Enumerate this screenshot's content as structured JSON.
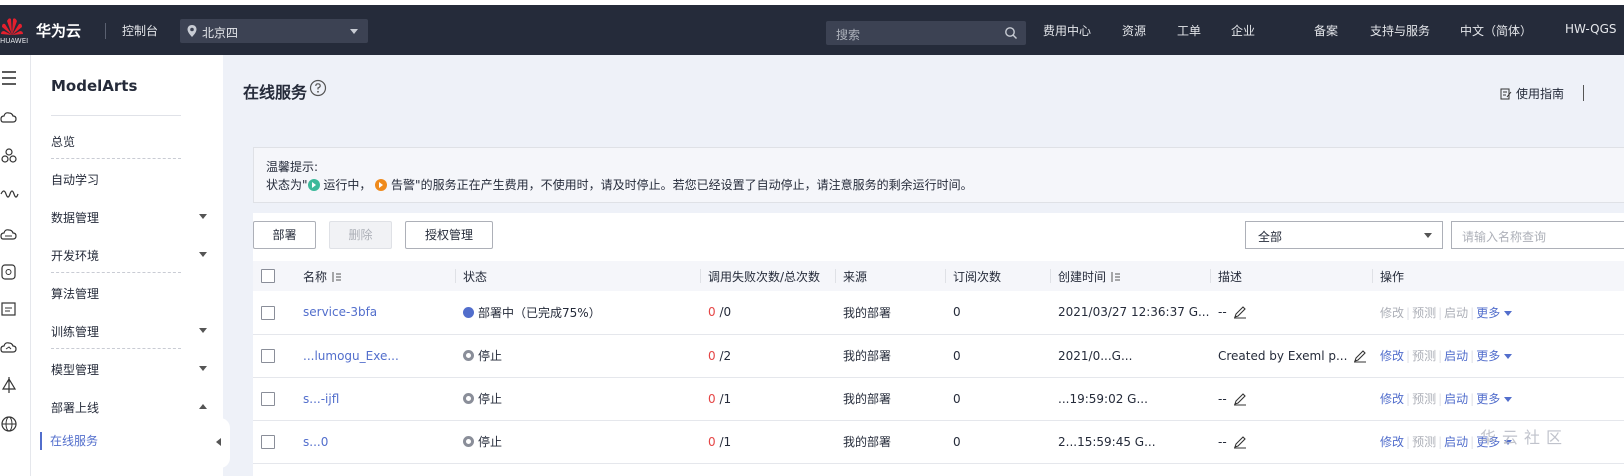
{
  "topbar": {
    "logo_text": "HUAWEI",
    "brand": "华为云",
    "console": "控制台",
    "region": "北京四",
    "search_placeholder": "搜索",
    "nav": [
      "费用中心",
      "资源",
      "工单",
      "企业",
      "备案",
      "支持与服务",
      "中文（简体）",
      "HW-QGS"
    ]
  },
  "sidenav": {
    "title": "ModelArts",
    "items": [
      {
        "label": "总览"
      },
      {
        "label": "自动学习"
      },
      {
        "label": "数据管理"
      },
      {
        "label": "开发环境"
      },
      {
        "label": "算法管理"
      },
      {
        "label": "训练管理"
      },
      {
        "label": "模型管理"
      },
      {
        "label": "部署上线"
      }
    ],
    "subitem": "在线服务"
  },
  "main": {
    "title": "在线服务",
    "guide": "使用指南",
    "tips": {
      "title": "温馨提示:",
      "line_pre": "状态为\"",
      "running": "运行中，",
      "alarm": "告警",
      "line_post": "\"的服务正在产生费用，不使用时，请及时停止。若您已经设置了自动停止，请注意服务的剩余运行时间。"
    },
    "buttons": {
      "deploy": "部署",
      "delete": "删除",
      "auth": "授权管理"
    },
    "filter": {
      "selected": "全部",
      "name_placeholder": "请输入名称查询"
    },
    "columns": [
      "名称",
      "状态",
      "调用失败次数/总次数",
      "来源",
      "订阅次数",
      "创建时间",
      "描述",
      "操作"
    ],
    "rows": [
      {
        "name": "service-3bfa",
        "status": "部署中",
        "status_extra": "（已完成75%）",
        "status_type": "deploying",
        "fail": "0",
        "total": "/0",
        "source": "我的部署",
        "subs": "0",
        "created": "2021/03/27 12:36:37 G...",
        "desc": "--"
      },
      {
        "name": "...lumogu_Exe...",
        "status": "停止",
        "status_extra": "",
        "status_type": "stopped",
        "fail": "0",
        "total": "/2",
        "source": "我的部署",
        "subs": "0",
        "created": "2021/0...G...",
        "desc": "Created by Exeml p..."
      },
      {
        "name": "s...-ijfl",
        "status": "停止",
        "status_extra": "",
        "status_type": "stopped",
        "fail": "0",
        "total": "/1",
        "source": "我的部署",
        "subs": "0",
        "created": "...19:59:02 G...",
        "desc": "--"
      },
      {
        "name": "s...0",
        "status": "停止",
        "status_extra": "",
        "status_type": "stopped",
        "fail": "0",
        "total": "/1",
        "source": "我的部署",
        "subs": "0",
        "created": "2...15:59:45 G...",
        "desc": "--"
      }
    ],
    "ops": {
      "modify": "修改",
      "predict": "预测",
      "start": "启动",
      "more": "更多"
    }
  },
  "watermark": "华云社区",
  "colors": {
    "topbar": "#252b3a",
    "link": "#526ecc",
    "error": "#e54545",
    "running": "#3cb99a",
    "alarm": "#ef8a1c"
  }
}
